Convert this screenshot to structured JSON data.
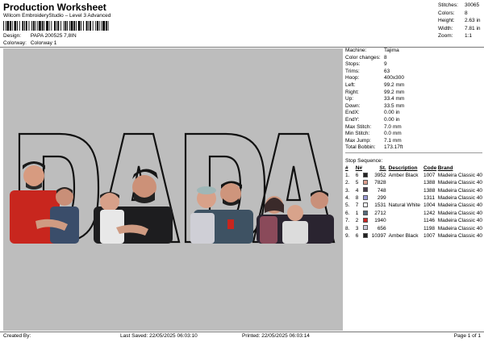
{
  "title": "Production Worksheet",
  "subtitle": "Wilcom EmbroideryStudio – Level 3 Advanced",
  "design_label": "Design:",
  "design_value": "PAPA 200525 7,8IN",
  "colorway_label": "Colorway:",
  "colorway_value": "Colorway 1",
  "stats": [
    {
      "label": "Stitches:",
      "value": "30065"
    },
    {
      "label": "Colors:",
      "value": "8"
    },
    {
      "label": "Height:",
      "value": "2.63 in"
    },
    {
      "label": "Width:",
      "value": "7.81 in"
    },
    {
      "label": "Zoom:",
      "value": "1:1"
    }
  ],
  "info": [
    {
      "label": "Machine:",
      "value": "Tajima"
    },
    {
      "label": "Color changes:",
      "value": "8"
    },
    {
      "label": "Stops:",
      "value": "9"
    },
    {
      "label": "Trims:",
      "value": "63"
    },
    {
      "label": "Hoop:",
      "value": "400x300"
    },
    {
      "label": "Left:",
      "value": "99.2 mm"
    },
    {
      "label": "Right:",
      "value": "99.2 mm"
    },
    {
      "label": "Up:",
      "value": "33.4 mm"
    },
    {
      "label": "Down:",
      "value": "33.5 mm"
    },
    {
      "label": "EndX:",
      "value": "0.00 in"
    },
    {
      "label": "EndY:",
      "value": "0.00 in"
    },
    {
      "label": "Max Stitch:",
      "value": "7.0 mm"
    },
    {
      "label": "Min Stitch:",
      "value": "0.0 mm"
    },
    {
      "label": "Max Jump:",
      "value": "7.1 mm"
    },
    {
      "label": "Total Bobbin:",
      "value": "173.17ft"
    }
  ],
  "stop_sequence_title": "Stop Sequence:",
  "stop_headers": {
    "num": "#",
    "n": "N#",
    "st": "St.",
    "desc": "Description",
    "code": "Code",
    "brand": "Brand"
  },
  "stops": [
    {
      "num": "1.",
      "idx": "6",
      "color": "#222222",
      "st": "3952",
      "desc": "Amber Black",
      "code": "1007",
      "brand": "Madeira Classic 40"
    },
    {
      "num": "2.",
      "idx": "5",
      "color": "#e0a090",
      "st": "7828",
      "desc": "",
      "code": "1388",
      "brand": "Madeira Classic 40"
    },
    {
      "num": "3.",
      "idx": "4",
      "color": "#4a3d4d",
      "st": "748",
      "desc": "",
      "code": "1388",
      "brand": "Madeira Classic 40"
    },
    {
      "num": "4.",
      "idx": "8",
      "color": "#9a9ad8",
      "st": "299",
      "desc": "",
      "code": "1311",
      "brand": "Madeira Classic 40"
    },
    {
      "num": "5.",
      "idx": "7",
      "color": "#f4f4f4",
      "st": "1531",
      "desc": "Natural White",
      "code": "1004",
      "brand": "Madeira Classic 40"
    },
    {
      "num": "6.",
      "idx": "1",
      "color": "#556a7a",
      "st": "2712",
      "desc": "",
      "code": "1242",
      "brand": "Madeira Classic 40"
    },
    {
      "num": "7.",
      "idx": "2",
      "color": "#cc2222",
      "st": "1940",
      "desc": "",
      "code": "1146",
      "brand": "Madeira Classic 40"
    },
    {
      "num": "8.",
      "idx": "3",
      "color": "#c8c8d8",
      "st": "656",
      "desc": "",
      "code": "1198",
      "brand": "Madeira Classic 40"
    },
    {
      "num": "9.",
      "idx": "6",
      "color": "#222222",
      "st": "10397",
      "desc": "Amber Black",
      "code": "1007",
      "brand": "Madeira Classic 40"
    }
  ],
  "footer": {
    "created": "Created By:",
    "saved": "Last Saved: 22/05/2025 06:03:10",
    "printed": "Printed: 22/05/2025 06:03:14",
    "page": "Page 1 of 1"
  },
  "artwork": {
    "letters": [
      "D",
      "A",
      "D",
      "A"
    ],
    "background": "#bdbdbd",
    "outline_color": "#111111"
  }
}
